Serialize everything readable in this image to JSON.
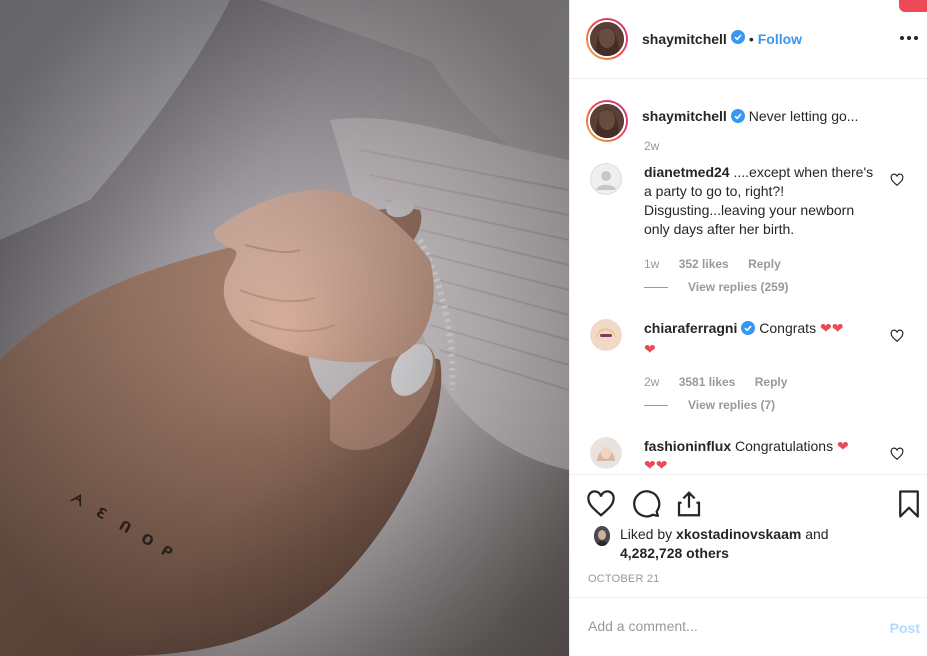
{
  "post": {
    "username": "shaymitchell",
    "follow_label": "Follow",
    "separator": "•",
    "more_label": "•••"
  },
  "caption": {
    "username": "shaymitchell",
    "text": "Never letting go...",
    "time": "2w"
  },
  "comments": [
    {
      "username": "dianetmed24",
      "text": "....except when there's a party to go to, right?! Disgusting...leaving your newborn only days after her birth.",
      "time": "1w",
      "likes": "352 likes",
      "reply_label": "Reply",
      "view_replies": "View replies (259)"
    },
    {
      "username": "chiaraferragni",
      "text": "Congrats",
      "time": "2w",
      "likes": "3581 likes",
      "reply_label": "Reply",
      "view_replies": "View replies (7)"
    },
    {
      "username": "fashioninflux",
      "text": "Congratulations"
    }
  ],
  "likes_summary": {
    "prefix": "Liked by",
    "user": "xkostadinovskaam",
    "connector": "and",
    "others": "4,282,728 others"
  },
  "date": "OCTOBER 21",
  "add_comment": {
    "placeholder": "Add a comment...",
    "post_label": "Post"
  },
  "icons": {
    "like": "heart-icon",
    "comment": "comment-icon",
    "share": "share-icon",
    "save": "bookmark-icon",
    "verified": "verified-badge-icon",
    "more": "more-options-icon",
    "comment_like": "heart-outline-icon"
  },
  "colors": {
    "link_blue": "#3897f0",
    "verified_blue": "#3897f0",
    "heart_red": "#ed4956",
    "muted_text": "#999999",
    "border": "#efefef"
  }
}
